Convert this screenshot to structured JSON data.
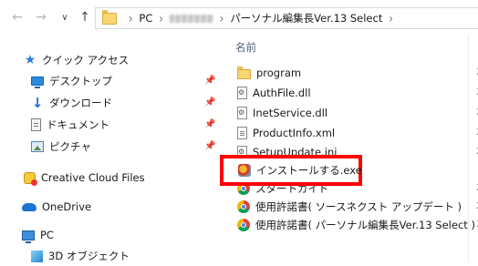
{
  "address_bar": {
    "breadcrumbs": [
      "PC",
      "パーソナル編集長Ver.13 Select"
    ]
  },
  "sidebar": {
    "quick_access": "クイック アクセス",
    "items": [
      {
        "label": "デスクトップ",
        "icon": "desktop-icon",
        "pinned": true
      },
      {
        "label": "ダウンロード",
        "icon": "download-icon",
        "pinned": true
      },
      {
        "label": "ドキュメント",
        "icon": "documents-icon",
        "pinned": true
      },
      {
        "label": "ピクチャ",
        "icon": "pictures-icon",
        "pinned": true
      }
    ],
    "creative_cloud": "Creative Cloud Files",
    "onedrive": "OneDrive",
    "pc": "PC",
    "objects3d": "3D オブジェクト"
  },
  "file_list": {
    "column_name": "名前",
    "files": [
      {
        "name": "program",
        "icon": "folder-icon"
      },
      {
        "name": "AuthFile.dll",
        "icon": "dll-file-icon"
      },
      {
        "name": "InetService.dll",
        "icon": "dll-file-icon"
      },
      {
        "name": "ProductInfo.xml",
        "icon": "xml-file-icon"
      },
      {
        "name": "SetupUpdate.ini",
        "icon": "ini-file-icon"
      },
      {
        "name": "インストールする.exe",
        "icon": "setup-exe-icon"
      },
      {
        "name": "スタートガイド",
        "icon": "html-chrome-icon"
      },
      {
        "name": "使用許諾書( ソースネクスト アップデート )",
        "icon": "html-chrome-icon"
      },
      {
        "name": "使用許諾書( パーソナル編集長Ver.13 Select )",
        "icon": "html-chrome-icon"
      }
    ],
    "trailing_char": "2"
  },
  "annotation": {
    "highlight_color": "#ff0000"
  }
}
